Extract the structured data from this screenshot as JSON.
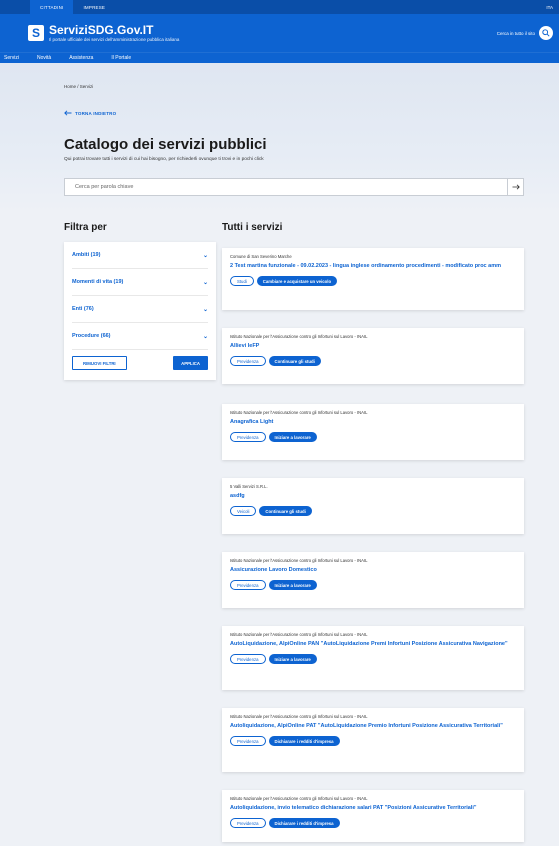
{
  "topbar": {
    "tab_active": "CITTADINI",
    "tab_other": "IMPRESE",
    "right": "ITA"
  },
  "header": {
    "logo_letter": "S",
    "name": "ServiziSDG.Gov.IT",
    "tagline": "Il portale ufficiale dei servizi dell'amministrazione pubblica italiana",
    "search_label": "Cerca in tutto il sito"
  },
  "nav": [
    "Servizi",
    "Novità",
    "Assistenza",
    "Il Portale"
  ],
  "breadcrumb": "Home / Servizi",
  "back_label": "TORNA INDIETRO",
  "page_title": "Catalogo dei servizi pubblici",
  "page_subtitle": "Qui potrai trovare tutti i servizi di cui hai bisogno, per richiederli ovunque ti trovi e in pochi click",
  "search": {
    "placeholder": "Cerca per parola chiave"
  },
  "filters": {
    "heading": "Filtra per",
    "items": [
      "Ambiti (19)",
      "Momenti di vita (19)",
      "Enti (76)",
      "Procedure (66)"
    ],
    "reset_label": "RIMUOVI FILTRI",
    "apply_label": "APPLICA"
  },
  "services_heading": "Tutti i servizi",
  "cards": [
    {
      "org": "Comune di San Severino Marche",
      "title": "2 Test martina funzionale - 09.02.2023 - lingua inglese ordinamento procedimenti - modificato proc amm",
      "tag": "Studi",
      "action": "Cambiare e acquistare un veicolo"
    },
    {
      "org": "Istituto Nazionale per l'Assicurazione contro gli Infortuni sul Lavoro - INAIL",
      "title": "Allievi IeFP",
      "tag": "Previdenza",
      "action": "Continuare gli studi"
    },
    {
      "org": "Istituto Nazionale per l'Assicurazione contro gli Infortuni sul Lavoro - INAIL",
      "title": "Anagrafica Light",
      "tag": "Previdenza",
      "action": "Iniziare a lavorare"
    },
    {
      "org": "5 Valli Servizi S.R.L.",
      "title": "asdfg",
      "tag": "Veicoli",
      "action": "Continuare gli studi"
    },
    {
      "org": "Istituto Nazionale per l'Assicurazione contro gli Infortuni sul Lavoro - INAIL",
      "title": "Assicurazione Lavoro Domestico",
      "tag": "Previdenza",
      "action": "Iniziare a lavorare"
    },
    {
      "org": "Istituto Nazionale per l'Assicurazione contro gli Infortuni sul Lavoro - INAIL",
      "title": "AutoLiquidazione, AlpiOnline PAN \"AutoLiquidazione Premi Infortuni Posizione Assicurativa Navigazione\"",
      "tag": "Previdenza",
      "action": "Iniziare a lavorare"
    },
    {
      "org": "Istituto Nazionale per l'Assicurazione contro gli Infortuni sul Lavoro - INAIL",
      "title": "Autoliquidazione, AlpiOnline PAT \"AutoLiquidazione Premio Infortuni Posizione Assicurativa Territoriali\"",
      "tag": "Previdenza",
      "action": "Dichiarare i redditi d'impresa"
    },
    {
      "org": "Istituto Nazionale per l'Assicurazione contro gli Infortuni sul Lavoro - INAIL",
      "title": "Autoliquidazione, invio telematico dichiarazione salari PAT \"Posizioni Assicurative Territoriali\"",
      "tag": "Previdenza",
      "action": "Dichiarare i redditi d'impresa"
    }
  ],
  "colors": {
    "brand": "#0d63d1",
    "brand_dark": "#0a4ea8",
    "background": "#eef1f6"
  }
}
